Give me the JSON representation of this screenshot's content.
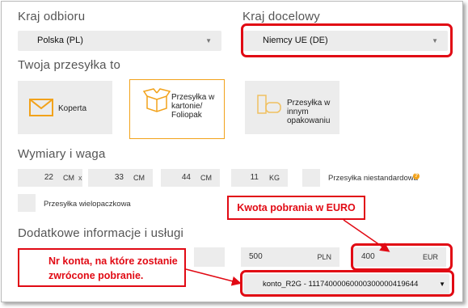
{
  "pickup_country": {
    "label": "Kraj odbioru",
    "value": "Polska (PL)"
  },
  "destination_country": {
    "label": "Kraj docelowy",
    "value": "Niemcy UE (DE)"
  },
  "parcel_type": {
    "label": "Twoja przesyłka to",
    "options": [
      {
        "label": "Koperta",
        "selected": false
      },
      {
        "label_lines": [
          "Przesyłka w",
          "kartonie/",
          "Foliopak"
        ],
        "selected": true
      },
      {
        "label_lines": [
          "Przesyłka w",
          "innym",
          "opakowaniu"
        ],
        "selected": false
      }
    ]
  },
  "dimensions": {
    "label": "Wymiary i waga",
    "length": {
      "value": "22",
      "unit": "CM"
    },
    "width": {
      "value": "33",
      "unit": "CM"
    },
    "height": {
      "value": "44",
      "unit": "CM"
    },
    "weight": {
      "value": "11",
      "unit": "KG"
    },
    "times_symbol": "x",
    "nonstandard_label": "Przesyłka niestandardowa",
    "info_symbol": "?",
    "multipack_label": "Przesyłka wielopaczkowa"
  },
  "additional": {
    "label": "Dodatkowe informacje i usługi",
    "cod_pln": {
      "value": "500",
      "unit": "PLN"
    },
    "cod_eur": {
      "value": "400",
      "unit": "EUR"
    },
    "account_select": "konto_R2G - 11174000060000300000419644"
  },
  "callouts": {
    "eur_amount": "Kwota pobrania w EURO",
    "account_line1": "Nr konta, na które zostanie",
    "account_line2": "zwrócone pobranie."
  },
  "colors": {
    "accent_red": "#e10a14",
    "accent_orange": "#f2a21a",
    "field_bg": "#ececec"
  }
}
